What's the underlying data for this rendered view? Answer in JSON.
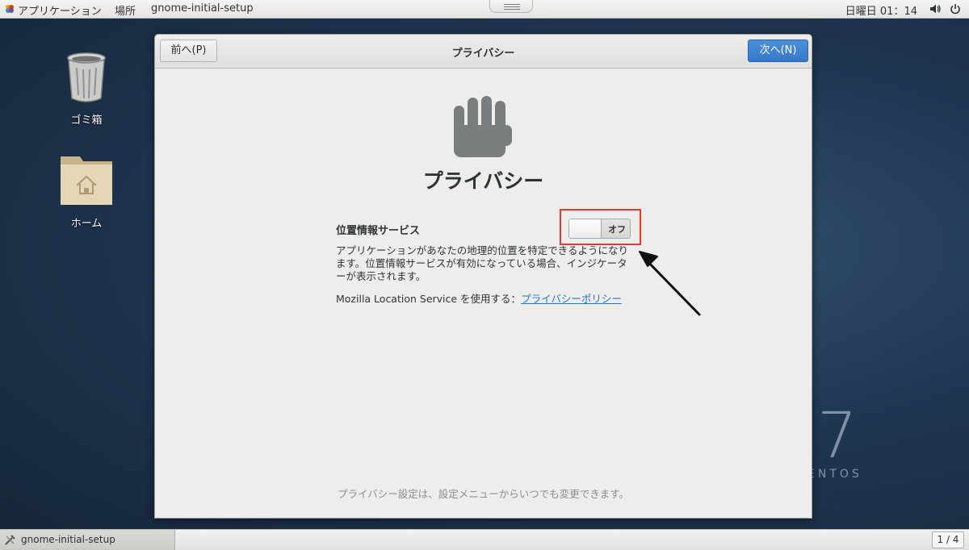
{
  "topbar": {
    "applications": "アプリケーション",
    "places": "場所",
    "active_app": "gnome-initial-setup",
    "clock": "日曜日 01：14"
  },
  "desktop": {
    "trash_label": "ゴミ箱",
    "home_label": "ホーム",
    "watermark_number": "7",
    "watermark_text": "ENTOS"
  },
  "dialog": {
    "prev_label": "前へ(P)",
    "next_label": "次へ(N)",
    "header_title": "プライバシー",
    "page_title": "プライバシー",
    "location_label": "位置情報サービス",
    "toggle_state": "オフ",
    "description": "アプリケーションがあなたの地理的位置を特定できるようになります。位置情報サービスが有効になっている場合、インジケーターが表示されます。",
    "mozilla_text": "Mozilla Location Service を使用する：",
    "privacy_link": "プライバシーポリシー",
    "footer_note": "プライバシー設定は、設定メニューからいつでも変更できます。"
  },
  "taskbar": {
    "task_label": "gnome-initial-setup",
    "workspace_pager": "1 / 4"
  },
  "colors": {
    "accent_blue": "#3578c9",
    "highlight_red": "#e53b2c",
    "link": "#2a76c6"
  }
}
